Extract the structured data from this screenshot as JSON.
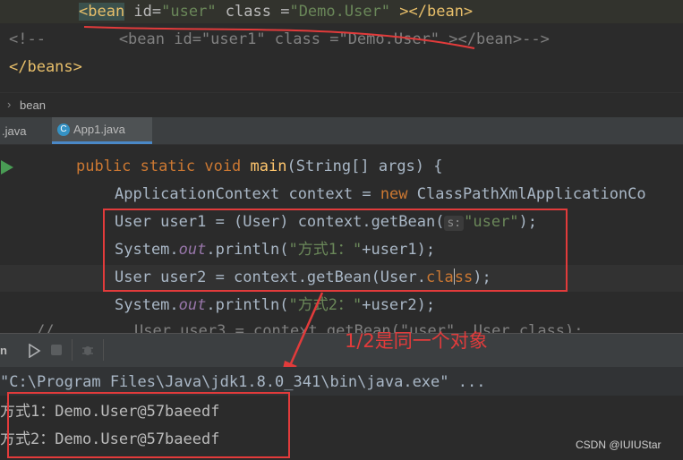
{
  "xml_editor": {
    "lines": [
      {
        "open_tag": "<bean",
        "attr1": " id=",
        "val1": "\"user\"",
        "attr2": " class =",
        "val2": "\"Demo.User\"",
        "close": " ></bean>"
      },
      {
        "comment": "<!--        <bean id=\"user1\" class =\"Demo.User\" ></bean>-->"
      },
      {
        "close_tag": "</beans>"
      }
    ]
  },
  "breadcrumb": {
    "chevron": "›",
    "item": "bean"
  },
  "tabs": [
    {
      "label": ".java",
      "active": false
    },
    {
      "label": "App1.java",
      "active": true,
      "icon": "class-c-icon"
    }
  ],
  "java_editor": {
    "line1": {
      "kw1": "public",
      "kw2": "static",
      "kw3": "void",
      "name": "main",
      "rest": "(String[] args) {"
    },
    "line2": {
      "a": "ApplicationContext context = ",
      "kw": "new",
      "b": " ClassPathXmlApplicationCo"
    },
    "line3": {
      "a": "User user1 = (User) context.getBean(",
      "hint": "s:",
      "str": "\"user\"",
      "b": ");"
    },
    "line4": {
      "a": "System.",
      "out": "out",
      "b": ".println(",
      "str": "\"方式1：\"",
      "c": "+user1);"
    },
    "line5": {
      "a": "User user2 = context.getBean(User.",
      "kw": "cla",
      "kw2": "ss",
      "b": ");"
    },
    "line6": {
      "a": "System.",
      "out": "out",
      "b": ".println(",
      "str": "\"方式2：\"",
      "c": "+user2);"
    },
    "line7_fragment": {
      "a": "User user3 = context.getBean(",
      "b": "\"user\", User.class);"
    },
    "comment_slashes": "//"
  },
  "annotation": {
    "text": "1/2是同一个对象",
    "color": "#e23b3b"
  },
  "run_panel": {
    "tab_label": "n",
    "command": "\"C:\\Program Files\\Java\\jdk1.8.0_341\\bin\\java.exe\" ...",
    "output": [
      "方式1：Demo.User@57baeedf",
      "方式2：Demo.User@57baeedf"
    ]
  },
  "watermark": "CSDN @IUIUStar",
  "colors": {
    "accent_red": "#e23b3b",
    "run_green": "#499c54",
    "tab_underline": "#4a88c7"
  }
}
